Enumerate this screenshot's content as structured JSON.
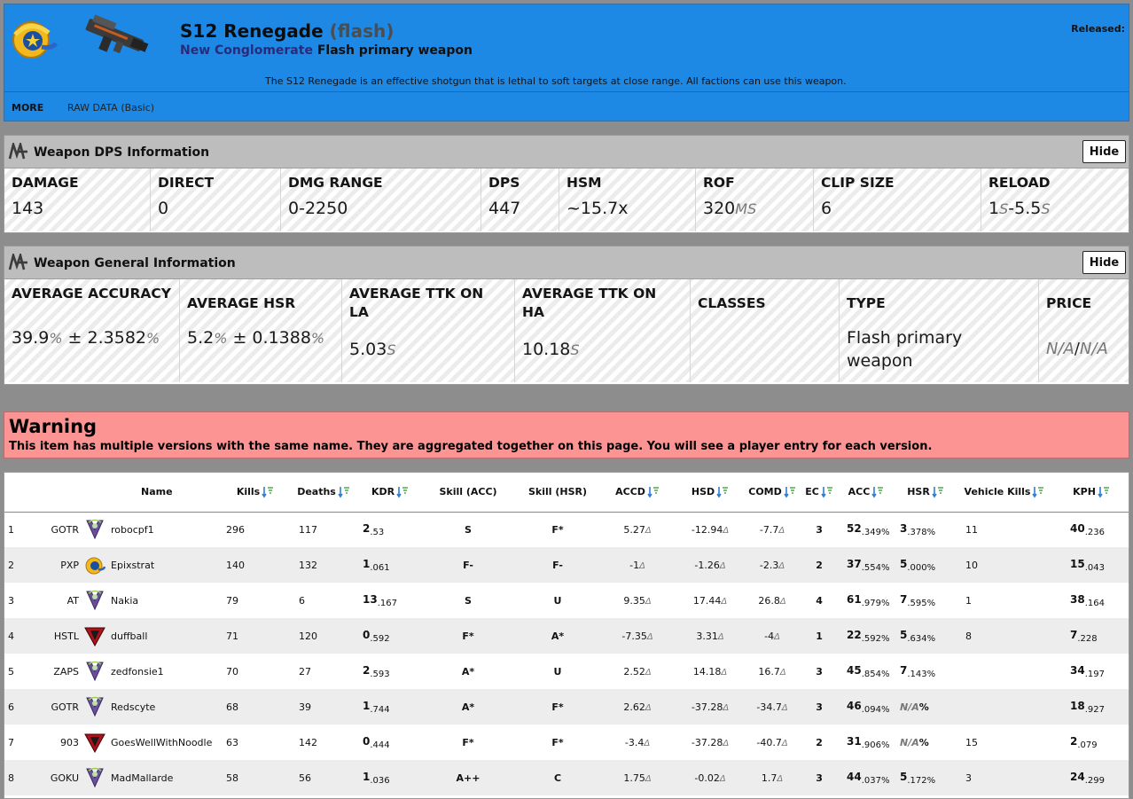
{
  "header": {
    "title": "S12 Renegade",
    "title_suffix": "(flash)",
    "faction": "New Conglomerate",
    "weapon_type": "Flash primary weapon",
    "released_label": "Released:",
    "description": "The S12 Renegade is an effective shotgun that is lethal to soft targets at close range. All factions can use this weapon.",
    "menu": {
      "more": "MORE",
      "raw_data": "RAW DATA (Basic)"
    },
    "colors": {
      "background": "#1d89e4",
      "faction_link": "#2a2a7a"
    }
  },
  "dps_panel": {
    "title": "Weapon DPS Information",
    "hide_label": "Hide",
    "stats": [
      {
        "label": "DAMAGE",
        "value": "143"
      },
      {
        "label": "DIRECT",
        "value": "0"
      },
      {
        "label": "DMG RANGE",
        "value": "0-2250"
      },
      {
        "label": "DPS",
        "value": "447"
      },
      {
        "label": "HSM",
        "value": "~15.7x"
      },
      {
        "label": "ROF",
        "value": "320",
        "unit": "MS"
      },
      {
        "label": "CLIP SIZE",
        "value": "6"
      },
      {
        "label": "RELOAD",
        "v1": "1",
        "u1": "S",
        "v2": "-5.5",
        "u2": "S"
      }
    ]
  },
  "general_panel": {
    "title": "Weapon General Information",
    "hide_label": "Hide",
    "accuracy": {
      "label": "AVERAGE ACCURACY",
      "v1": "39.9",
      "u1": "%",
      "pm": " ± ",
      "v2": "2.3582",
      "u2": "%"
    },
    "hsr": {
      "label": "AVERAGE HSR",
      "v1": "5.2",
      "u1": "%",
      "pm": " ± ",
      "v2": "0.1388",
      "u2": "%"
    },
    "ttk_la": {
      "label": "AVERAGE TTK ON LA",
      "value": "5.03",
      "unit": "S"
    },
    "ttk_ha": {
      "label": "AVERAGE TTK ON HA",
      "value": "10.18",
      "unit": "S"
    },
    "classes": {
      "label": "CLASSES"
    },
    "type": {
      "label": "TYPE",
      "value": "Flash primary weapon"
    },
    "price": {
      "label": "PRICE",
      "v1": "N/A",
      "sep": "/",
      "v2": "N/A"
    }
  },
  "warning": {
    "title": "Warning",
    "text": "This item has multiple versions with the same name. They are aggregated together on this page. You will see a player entry for each version."
  },
  "players_table": {
    "headers": {
      "name": "Name",
      "kills": "Kills",
      "deaths": "Deaths",
      "kdr": "KDR",
      "skill_acc": "Skill (ACC)",
      "skill_hsr": "Skill (HSR)",
      "accd": "ACCD",
      "hsd": "HSD",
      "comd": "COMD",
      "ec": "EC",
      "acc": "ACC",
      "hsr": "HSR",
      "vehicle_kills": "Vehicle Kills",
      "kph": "KPH"
    },
    "delta_symbol": "Δ",
    "pct_symbol": "%",
    "rows": [
      {
        "rank": "1",
        "outfit": "GOTR",
        "icon": "vs-faction-icon",
        "name": "robocpf1",
        "kills": "296",
        "deaths": "117",
        "kdr_i": "2",
        "kdr_f": ".53",
        "skill_acc": "S",
        "skill_acc_color": "red",
        "skill_hsr": "F*",
        "skill_hsr_color": "red",
        "accd": "5.27",
        "hsd": "-12.94",
        "comd": "-7.7",
        "ec": "3",
        "acc_i": "52",
        "acc_f": ".349",
        "hsr_i": "3",
        "hsr_f": ".378",
        "vk": "11",
        "kph_i": "40",
        "kph_f": ".236"
      },
      {
        "rank": "2",
        "outfit": "PXP",
        "icon": "nc-faction-icon",
        "name": "Epixstrat",
        "kills": "140",
        "deaths": "132",
        "kdr_i": "1",
        "kdr_f": ".061",
        "skill_acc": "F-",
        "skill_acc_color": "red",
        "skill_hsr": "F-",
        "skill_hsr_color": "red",
        "accd": "-1",
        "hsd": "-1.26",
        "comd": "-2.3",
        "ec": "2",
        "acc_i": "37",
        "acc_f": ".554",
        "hsr_i": "5",
        "hsr_f": ".000",
        "vk": "10",
        "kph_i": "15",
        "kph_f": ".043"
      },
      {
        "rank": "3",
        "outfit": "AT",
        "icon": "vs-faction-icon",
        "name": "Nakia",
        "kills": "79",
        "deaths": "6",
        "kdr_i": "13",
        "kdr_f": ".167",
        "skill_acc": "S",
        "skill_acc_color": "red",
        "skill_hsr": "U",
        "skill_hsr_color": "grey",
        "accd": "9.35",
        "hsd": "17.44",
        "comd": "26.8",
        "ec": "4",
        "acc_i": "61",
        "acc_f": ".979",
        "hsr_i": "7",
        "hsr_f": ".595",
        "vk": "1",
        "kph_i": "38",
        "kph_f": ".164"
      },
      {
        "rank": "4",
        "outfit": "HSTL",
        "icon": "tr-faction-icon",
        "name": "duffball",
        "kills": "71",
        "deaths": "120",
        "kdr_i": "0",
        "kdr_f": ".592",
        "skill_acc": "F*",
        "skill_acc_color": "red",
        "skill_hsr": "A*",
        "skill_hsr_color": "green",
        "accd": "-7.35",
        "hsd": "3.31",
        "comd": "-4",
        "ec": "1",
        "acc_i": "22",
        "acc_f": ".592",
        "hsr_i": "5",
        "hsr_f": ".634",
        "vk": "8",
        "kph_i": "7",
        "kph_f": ".228"
      },
      {
        "rank": "5",
        "outfit": "ZAPS",
        "icon": "vs-faction-icon",
        "name": "zedfonsie1",
        "kills": "70",
        "deaths": "27",
        "kdr_i": "2",
        "kdr_f": ".593",
        "skill_acc": "A*",
        "skill_acc_color": "green",
        "skill_hsr": "U",
        "skill_hsr_color": "grey",
        "accd": "2.52",
        "hsd": "14.18",
        "comd": "16.7",
        "ec": "3",
        "acc_i": "45",
        "acc_f": ".854",
        "hsr_i": "7",
        "hsr_f": ".143",
        "vk": "",
        "kph_i": "34",
        "kph_f": ".197"
      },
      {
        "rank": "6",
        "outfit": "GOTR",
        "icon": "vs-faction-icon",
        "name": "Redscyte",
        "kills": "68",
        "deaths": "39",
        "kdr_i": "1",
        "kdr_f": ".744",
        "skill_acc": "A*",
        "skill_acc_color": "green",
        "skill_hsr": "F*",
        "skill_hsr_color": "red",
        "accd": "2.62",
        "hsd": "-37.28",
        "comd": "-34.7",
        "ec": "3",
        "acc_i": "46",
        "acc_f": ".094",
        "hsr_na": "N/A",
        "vk": "",
        "kph_i": "18",
        "kph_f": ".927"
      },
      {
        "rank": "7",
        "outfit": "903",
        "icon": "tr-faction-icon",
        "name": "GoesWellWithNoodle",
        "kills": "63",
        "deaths": "142",
        "kdr_i": "0",
        "kdr_f": ".444",
        "skill_acc": "F*",
        "skill_acc_color": "red",
        "skill_hsr": "F*",
        "skill_hsr_color": "red",
        "accd": "-3.4",
        "hsd": "-37.28",
        "comd": "-40.7",
        "ec": "2",
        "acc_i": "31",
        "acc_f": ".906",
        "hsr_na": "N/A",
        "vk": "15",
        "kph_i": "2",
        "kph_f": ".079"
      },
      {
        "rank": "8",
        "outfit": "GOKU",
        "icon": "vs-faction-icon",
        "name": "MadMallarde",
        "kills": "58",
        "deaths": "56",
        "kdr_i": "1",
        "kdr_f": ".036",
        "skill_acc": "A++",
        "skill_acc_color": "teal",
        "skill_hsr": "C",
        "skill_hsr_color": "black",
        "accd": "1.75",
        "hsd": "-0.02",
        "comd": "1.7",
        "ec": "3",
        "acc_i": "44",
        "acc_f": ".037",
        "hsr_i": "5",
        "hsr_f": ".172",
        "vk": "3",
        "kph_i": "24",
        "kph_f": ".299"
      }
    ]
  }
}
